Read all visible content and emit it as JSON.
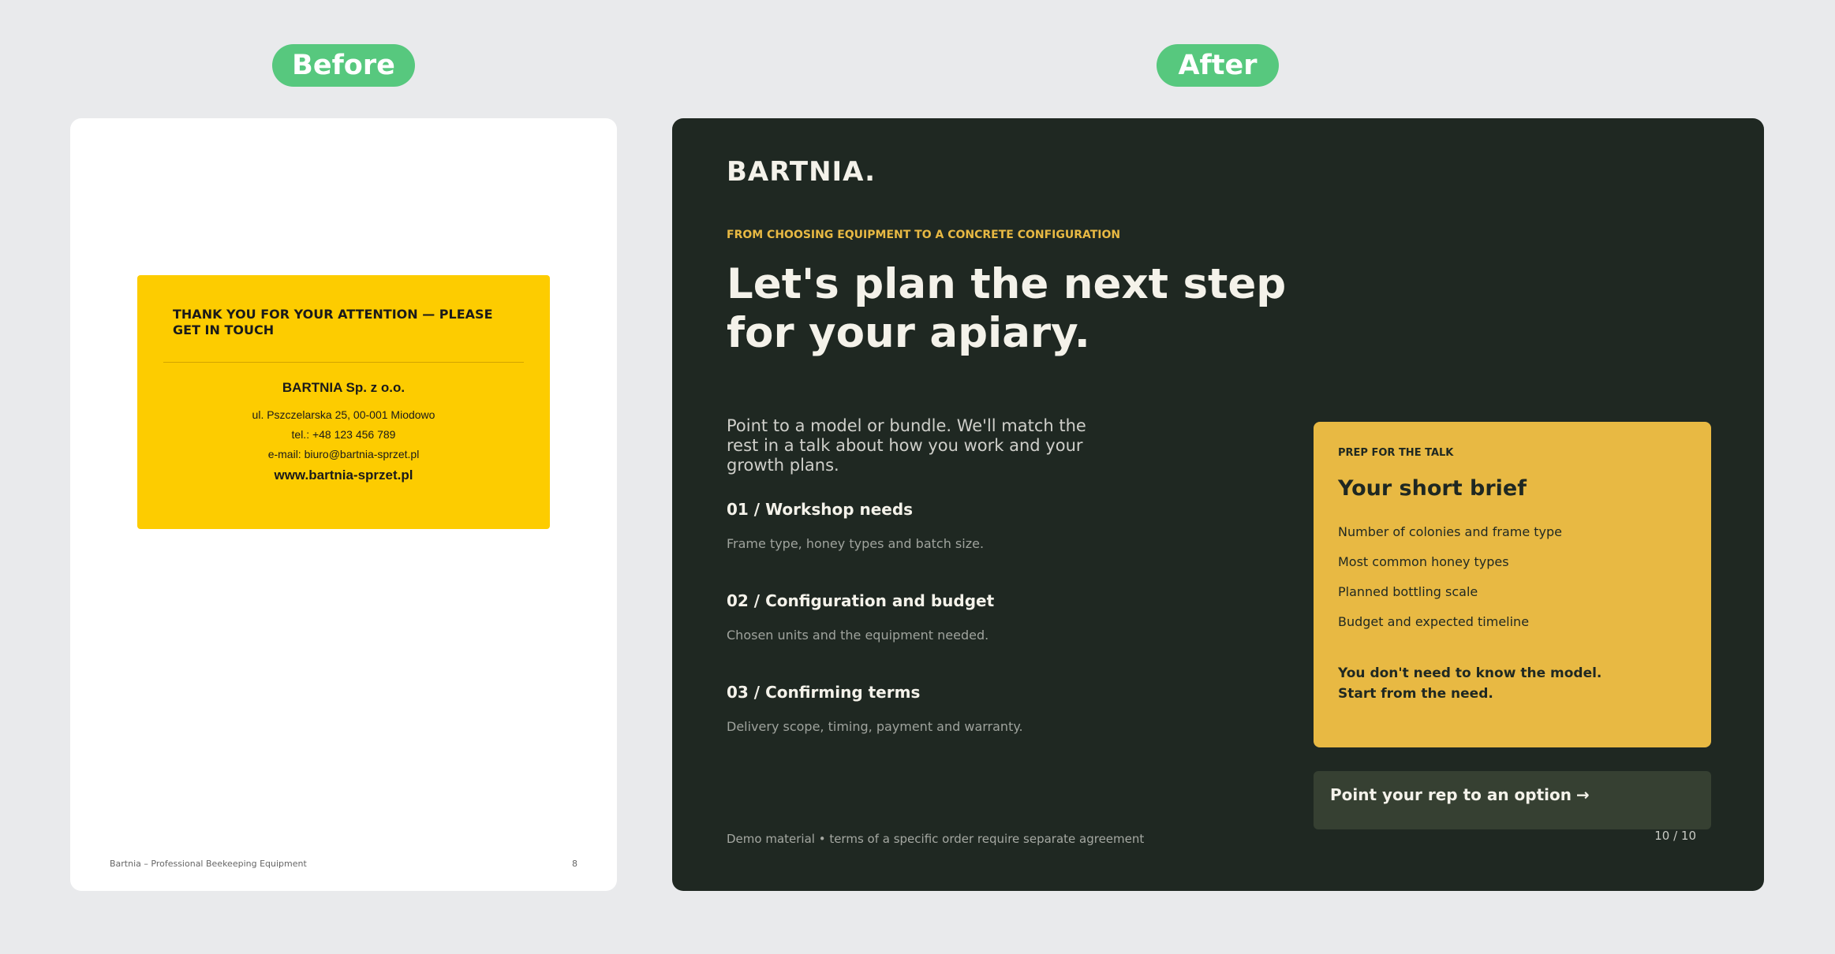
{
  "labels": {
    "before": "Before",
    "after": "After"
  },
  "before": {
    "card": {
      "heading": "THANK YOU FOR YOUR ATTENTION — PLEASE GET IN TOUCH",
      "company": "BARTNIA Sp. z o.o.",
      "address": "ul. Pszczelarska 25, 00-001 Miodowo",
      "phone": "tel.: +48 123 456 789",
      "email": "e-mail: biuro@bartnia-sprzet.pl",
      "website": "www.bartnia-sprzet.pl",
      "color": "#fdcc00"
    },
    "footer": {
      "left": "Bartnia – Professional Beekeeping Equipment",
      "page": "8"
    }
  },
  "after": {
    "brand": "BARTNIA.",
    "eyebrow": "FROM CHOOSING EQUIPMENT TO A CONCRETE CONFIGURATION",
    "headline": "Let's plan the next step for your apiary.",
    "intro": "Point to a model or bundle. We'll match the rest in a talk about how you work and your growth plans.",
    "steps": [
      {
        "title": "01 / Workshop needs",
        "desc": "Frame type, honey types and batch size."
      },
      {
        "title": "02 / Configuration and budget",
        "desc": "Chosen units and the equipment needed."
      },
      {
        "title": "03 / Confirming terms",
        "desc": "Delivery scope, timing, payment and warranty."
      }
    ],
    "brief": {
      "eyebrow": "PREP FOR THE TALK",
      "title": "Your short brief",
      "items": [
        "Number of colonies and frame type",
        "Most common honey types",
        "Planned bottling scale",
        "Budget and expected timeline"
      ],
      "note_line1": "You don't need to know the model.",
      "note_line2": "Start from the need.",
      "color": "#e8b943"
    },
    "cta": {
      "label": "Point your rep to an option",
      "arrow": "→"
    },
    "footer": "Demo material • terms of a specific order require separate agreement",
    "page": "10 / 10",
    "background": "#1f2822",
    "accent": "#e8b943"
  }
}
